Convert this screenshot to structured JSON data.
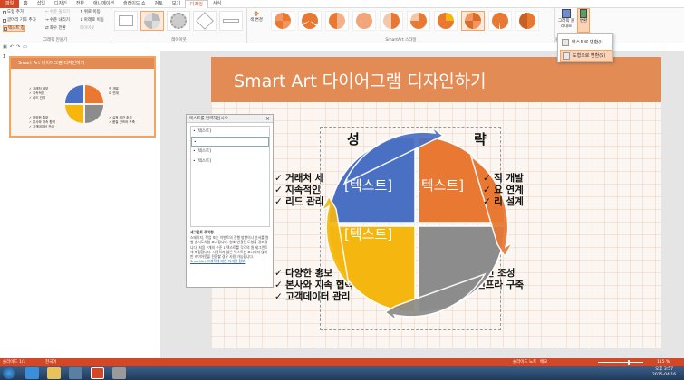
{
  "tabs": [
    "파일",
    "홈",
    "삽입",
    "디자인",
    "전환",
    "애니메이션",
    "슬라이드 쇼",
    "검토",
    "보기",
    "디자인",
    "서식"
  ],
  "ribbon": {
    "create_group": {
      "label": "그래픽 만들기",
      "add_shape": "도형 추가",
      "add_bullet": "글머리 기호 추가",
      "text_pane": "텍스트 창",
      "promote": "수준 올리기",
      "demote": "수준 내리기",
      "rtl": "좌우 전환",
      "move_up": "위로 이동",
      "move_down": "아래로 이동",
      "layout": "레이아웃"
    },
    "layouts_label": "레이아웃",
    "change_colors": "색 변경",
    "styles_label": "SmartArt 스타일",
    "reset_graphic": "그래픽 원래대로",
    "reset_label": "원래대로",
    "convert": "변환"
  },
  "convert_menu": {
    "to_text": "텍스트로 변환(I)",
    "to_shapes": "도형으로 변환(S)"
  },
  "thumb": {
    "number": "1",
    "title": "Smart Art 다이어그램 디자인하기"
  },
  "slide": {
    "title": "Smart Art 다이어그램 디자인하기",
    "center_title_left": "성",
    "center_title_right": "략",
    "left_top_bullets": [
      "거래처 세",
      "지속적인",
      "리드 관리"
    ],
    "right_top_bullets": [
      "직 개발",
      "요 연계",
      "리 설계"
    ],
    "left_bottom_bullets": [
      "다양한 홍보",
      "본사와 지속 협력",
      "고객데이터 관리"
    ],
    "right_bottom_bullets": [
      "실적 여건 조성",
      "품질 인프라 구축"
    ],
    "segments": [
      "[텍스트]",
      "[텍스트]",
      "[텍스트]"
    ]
  },
  "text_pane": {
    "header": "텍스트를 입력하십시오.",
    "close": "×",
    "items": [
      "[텍스트]",
      "",
      "[텍스트]",
      "[텍스트]"
    ],
    "desc_title": "세그먼트 주기형",
    "desc_body": "스테이지, 작업 또는 이벤트의 진행 방향이나 순서를 원형 순서도처럼 표시합니다. 원호 연결된 도형을 강조합니다. 처음 7개의 수준 1 텍스트를 각각의 원 세그먼트에 매핑합니다. 사용하지 않은 텍스트는 표시되지 않지만 레이아웃을 전환할 경우 사용 가능합니다.",
    "link": "SmartArt 그래픽에 대한 자세한 정보"
  },
  "status": {
    "slide": "슬라이드 1/1",
    "lang": "한국어",
    "notes": "슬라이드 노트",
    "memo": "메모",
    "zoom": "115 %"
  },
  "clock": {
    "time": "오후 3:57",
    "date": "2015-04-16"
  },
  "colors": {
    "brand": "#d24726",
    "title_bar": "#e38b55",
    "seg_blue": "#4a70c4",
    "seg_orange": "#e87832",
    "seg_yellow": "#f5b70f",
    "seg_gray": "#8c8c8c"
  }
}
